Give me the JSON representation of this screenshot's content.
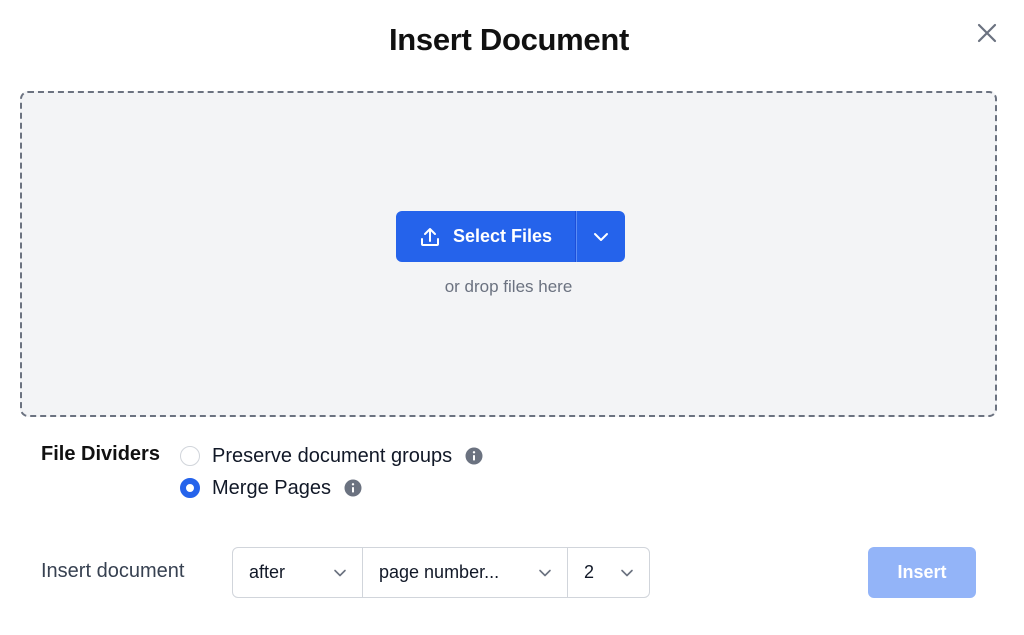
{
  "dialog": {
    "title": "Insert Document",
    "close_icon": "close-icon"
  },
  "dropzone": {
    "select_files_label": "Select Files",
    "upload_icon": "upload-icon",
    "dropdown_icon": "chevron-down-icon",
    "hint": "or drop files here"
  },
  "file_dividers": {
    "label": "File Dividers",
    "options": [
      {
        "label": "Preserve document groups",
        "selected": false,
        "info_icon": "info-icon"
      },
      {
        "label": "Merge Pages",
        "selected": true,
        "info_icon": "info-icon"
      }
    ]
  },
  "insert_position": {
    "label": "Insert document",
    "selects": [
      {
        "value": "after",
        "icon": "chevron-down-icon"
      },
      {
        "value": "page number...",
        "icon": "chevron-down-icon"
      },
      {
        "value": "2",
        "icon": "chevron-down-icon"
      }
    ]
  },
  "actions": {
    "insert_label": "Insert",
    "insert_enabled": false
  },
  "colors": {
    "accent": "#2563eb",
    "accent_disabled": "#93b4f8",
    "dropzone_bg": "#f3f4f6",
    "dropzone_border": "#6b7280",
    "muted_text": "#6b7280"
  }
}
